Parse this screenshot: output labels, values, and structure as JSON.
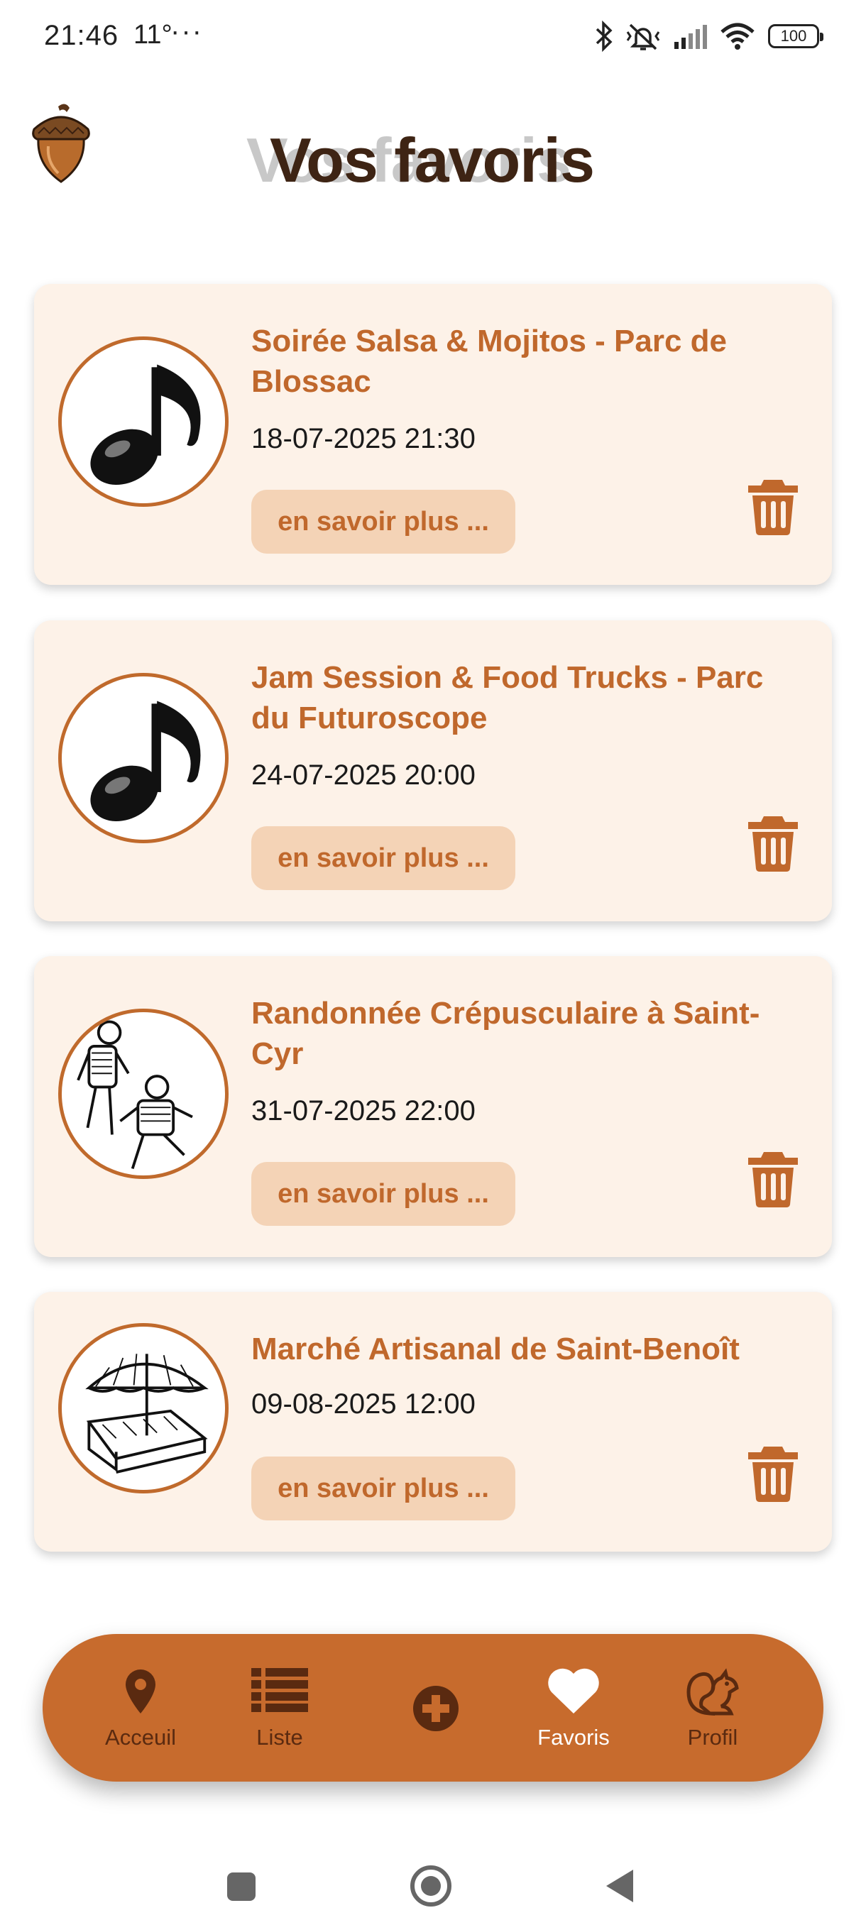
{
  "status_bar": {
    "time": "21:46",
    "temperature": "11°",
    "more": "···",
    "battery": "100"
  },
  "header": {
    "title": "Vos favoris",
    "logo_icon": "acorn-icon"
  },
  "favorites": [
    {
      "title": "Soirée Salsa & Mojitos - Parc de Blossac",
      "date": "18-07-2025 21:30",
      "more_label": "en savoir plus ...",
      "thumbnail_icon": "music-note-icon"
    },
    {
      "title": "Jam Session & Food Trucks - Parc du Futuroscope",
      "date": "24-07-2025 20:00",
      "more_label": "en savoir plus ...",
      "thumbnail_icon": "music-note-icon"
    },
    {
      "title": "Randonnée Crépusculaire à Saint-Cyr",
      "date": "31-07-2025 22:00",
      "more_label": "en savoir plus ...",
      "thumbnail_icon": "hikers-sketch-icon"
    },
    {
      "title": "Marché Artisanal de Saint-Benoît",
      "date": "09-08-2025 12:00",
      "more_label": "en savoir plus ...",
      "thumbnail_icon": "market-stall-sketch-icon"
    }
  ],
  "bottom_nav": {
    "items": [
      {
        "label": "Acceuil",
        "icon": "map-pin-icon",
        "active": false
      },
      {
        "label": "Liste",
        "icon": "list-icon",
        "active": false
      },
      {
        "label": "",
        "icon": "plus-circle-icon",
        "active": false
      },
      {
        "label": "Favoris",
        "icon": "heart-icon",
        "active": true
      },
      {
        "label": "Profil",
        "icon": "squirrel-icon",
        "active": false
      }
    ]
  },
  "colors": {
    "accent": "#c76b2d",
    "card_bg": "#fdf2e8",
    "title_text": "#3e2414",
    "button_bg": "#f4d3b6"
  }
}
